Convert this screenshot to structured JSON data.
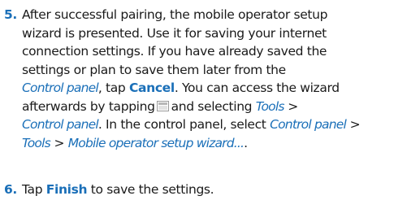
{
  "steps": [
    {
      "number": "5.",
      "lines": [
        {
          "t1": "After successful pairing, the mobile operator setup"
        },
        {
          "t1": "wizard is presented. Use it for saving your internet"
        },
        {
          "t1": "connection settings. If you have already saved the"
        },
        {
          "t1": "settings or plan to save them later from the"
        },
        {
          "link1": "Control panel",
          "t1": ", tap ",
          "cmd1": "Cancel",
          "t2": ". You can access the wizard"
        },
        {
          "t1": "afterwards by tapping",
          "icon": "menu-icon",
          "t2": "and selecting ",
          "link1": "Tools",
          "t3": " >"
        },
        {
          "link1": "Control panel",
          "t1": ". In the control panel, select ",
          "link2": "Control panel",
          "t2": " >"
        },
        {
          "link1": "Tools",
          "t1": " > ",
          "link2": "Mobile operator setup wizard...",
          "t2": "."
        }
      ]
    },
    {
      "number": "6.",
      "lines": [
        {
          "t1": "Tap ",
          "cmd1": "Finish",
          "t2": " to save the settings."
        }
      ]
    }
  ],
  "colors": {
    "accent": "#1a6fb8",
    "text": "#1a1a1a"
  }
}
